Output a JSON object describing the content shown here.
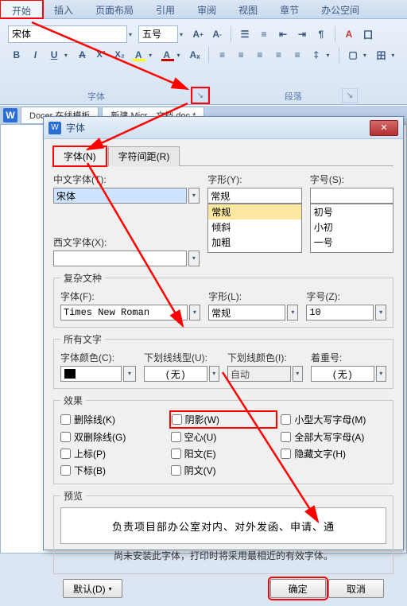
{
  "tabs": [
    "开始",
    "插入",
    "页面布局",
    "引用",
    "审阅",
    "视图",
    "章节",
    "办公空间"
  ],
  "ribbon": {
    "font_name": "宋体",
    "font_size": "五号",
    "group_font": "字体",
    "group_para": "段落"
  },
  "doctabs": {
    "left": "Docer 在线模板",
    "right": "新建 Micr…文档.doc *"
  },
  "dialog": {
    "title": "字体",
    "tabs": {
      "font": "字体(N)",
      "spacing": "字符间距(R)"
    },
    "cn_font_label": "中文字体(T):",
    "cn_font_value": "宋体",
    "west_font_label": "西文字体(X):",
    "west_font_value": "",
    "style_label": "字形(Y):",
    "style_value": "常规",
    "style_list": [
      "常规",
      "倾斜",
      "加粗"
    ],
    "size_label": "字号(S):",
    "size_value": "",
    "size_list": [
      "初号",
      "小初",
      "一号"
    ],
    "complex_legend": "复杂文种",
    "c_font_label": "字体(F):",
    "c_font_value": "Times New Roman",
    "c_style_label": "字形(L):",
    "c_style_value": "常规",
    "c_size_label": "字号(Z):",
    "c_size_value": "10",
    "alltext_legend": "所有文字",
    "color_label": "字体颜色(C):",
    "underline_label": "下划线线型(U):",
    "underline_value": "(无)",
    "ul_color_label": "下划线颜色(I):",
    "ul_color_value": "自动",
    "emphasis_label": "着重号:",
    "emphasis_value": "(无)",
    "effects_legend": "效果",
    "chk": {
      "strike": "删除线(K)",
      "dstrike": "双删除线(G)",
      "super": "上标(P)",
      "sub": "下标(B)",
      "shadow": "阴影(W)",
      "hollow": "空心(U)",
      "emboss": "阳文(E)",
      "engrave": "阴文(V)",
      "smallcaps": "小型大写字母(M)",
      "allcaps": "全部大写字母(A)",
      "hidden": "隐藏文字(H)"
    },
    "preview_legend": "预览",
    "preview_text": "负责项目部办公室对内、对外发函、申请、通",
    "note": "尚未安装此字体，打印时将采用最相近的有效字体。",
    "btn_default": "默认(D)",
    "btn_ok": "确定",
    "btn_cancel": "取消"
  }
}
